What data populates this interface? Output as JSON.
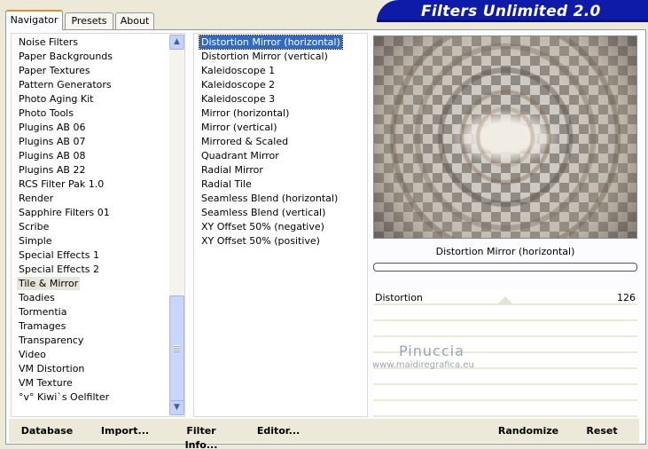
{
  "tabs": [
    {
      "label": "Navigator"
    },
    {
      "label": "Presets"
    },
    {
      "label": "About"
    }
  ],
  "app_title": "Filters Unlimited 2.0",
  "categories": [
    "Noise Filters",
    "Paper Backgrounds",
    "Paper Textures",
    "Pattern Generators",
    "Photo Aging Kit",
    "Photo Tools",
    "Plugins AB 06",
    "Plugins AB 07",
    "Plugins AB 08",
    "Plugins AB 22",
    "RCS Filter Pak 1.0",
    "Render",
    "Sapphire Filters 01",
    "Scribe",
    "Simple",
    "Special Effects 1",
    "Special Effects 2",
    "Tile & Mirror",
    "Toadies",
    "Tormentia",
    "Tramages",
    "Transparency",
    "Video",
    "VM Distortion",
    "VM Texture",
    "°v° Kiwi`s Oelfilter"
  ],
  "selected_category": "Tile & Mirror",
  "filters": [
    "Distortion Mirror (horizontal)",
    "Distortion Mirror (vertical)",
    "Kaleidoscope 1",
    "Kaleidoscope 2",
    "Kaleidoscope 3",
    "Mirror (horizontal)",
    "Mirror (vertical)",
    "Mirrored & Scaled",
    "Quadrant Mirror",
    "Radial Mirror",
    "Radial Tile",
    "Seamless Blend (horizontal)",
    "Seamless Blend (vertical)",
    "XY Offset 50% (negative)",
    "XY Offset 50% (positive)"
  ],
  "selected_filter": "Distortion Mirror (horizontal)",
  "preview_caption": "Distortion Mirror (horizontal)",
  "progress": 0,
  "parameters": [
    {
      "label": "Distortion",
      "value": "126"
    }
  ],
  "watermark": {
    "line1": "Pinuccia",
    "line2": "www.maidiregrafica.eu"
  },
  "buttons": {
    "database": "Database",
    "import": "Import...",
    "filter_info": "Filter Info...",
    "editor": "Editor...",
    "randomize": "Randomize",
    "reset": "Reset"
  },
  "colors": {
    "title_banner": "#0e1aa8",
    "selection": "#316ac5",
    "dialog_bg": "#ece9d8"
  }
}
